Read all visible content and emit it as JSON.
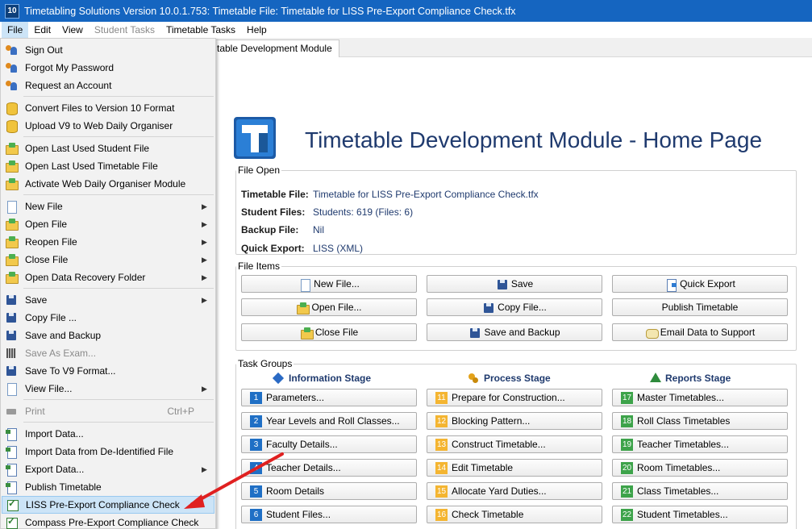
{
  "window": {
    "app_icon_text": "10",
    "title": "Timetabling Solutions Version 10.0.1.753: Timetable File: Timetable for LISS Pre-Export Compliance Check.tfx"
  },
  "menubar": [
    "File",
    "Edit",
    "View",
    "Student Tasks",
    "Timetable Tasks",
    "Help"
  ],
  "tab": {
    "label": "Timetable Development Module",
    "visible_label": "table Development Module"
  },
  "page": {
    "title": "Timetable Development Module - Home Page"
  },
  "file_open": {
    "legend": "File Open",
    "rows": [
      {
        "key": "Timetable File:",
        "value": "Timetable for LISS Pre-Export Compliance Check.tfx"
      },
      {
        "key": "Student Files:",
        "value": "Students: 619 (Files: 6)"
      },
      {
        "key": "Backup File:",
        "value": "Nil"
      },
      {
        "key": "Quick Export:",
        "value": "LISS (XML)"
      }
    ]
  },
  "file_items": {
    "legend": "File Items",
    "buttons": [
      {
        "label": "New File...",
        "icon": "new-file-icon"
      },
      {
        "label": "Save",
        "icon": "save-icon"
      },
      {
        "label": "Quick Export",
        "icon": "export-icon"
      },
      {
        "label": "Open File...",
        "icon": "open-folder-icon"
      },
      {
        "label": "Copy File...",
        "icon": "save-icon"
      },
      {
        "label": "Publish Timetable",
        "icon": ""
      },
      {
        "label": "Close File",
        "icon": "close-folder-icon"
      },
      {
        "label": "Save and Backup",
        "icon": "save-icon"
      },
      {
        "label": "Email Data to Support",
        "icon": "email-icon"
      }
    ]
  },
  "task_groups": {
    "legend": "Task Groups",
    "stages": [
      {
        "name": "Information Stage",
        "icon": "info-diamond-icon",
        "color": "#1f6fc5",
        "tasks": [
          {
            "num": "1",
            "label": "Parameters..."
          },
          {
            "num": "2",
            "label": "Year Levels and Roll Classes..."
          },
          {
            "num": "3",
            "label": "Faculty Details..."
          },
          {
            "num": "4",
            "label": "Teacher Details..."
          },
          {
            "num": "5",
            "label": "Room Details"
          },
          {
            "num": "6",
            "label": "Student Files..."
          }
        ]
      },
      {
        "name": "Process Stage",
        "icon": "gears-icon",
        "color": "#f4b531",
        "tasks": [
          {
            "num": "11",
            "label": "Prepare for Construction..."
          },
          {
            "num": "12",
            "label": "Blocking Pattern..."
          },
          {
            "num": "13",
            "label": "Construct Timetable..."
          },
          {
            "num": "14",
            "label": "Edit Timetable"
          },
          {
            "num": "15",
            "label": "Allocate Yard Duties..."
          },
          {
            "num": "16",
            "label": "Check Timetable"
          }
        ]
      },
      {
        "name": "Reports Stage",
        "icon": "tree-icon",
        "color": "#3da34a",
        "tasks": [
          {
            "num": "17",
            "label": "Master Timetables..."
          },
          {
            "num": "18",
            "label": "Roll Class Timetables"
          },
          {
            "num": "19",
            "label": "Teacher Timetables..."
          },
          {
            "num": "20",
            "label": "Room Timetables..."
          },
          {
            "num": "21",
            "label": "Class Timetables..."
          },
          {
            "num": "22",
            "label": "Student Timetables..."
          }
        ]
      }
    ]
  },
  "file_menu": [
    {
      "label": "Sign Out",
      "icon": "users-icon"
    },
    {
      "label": "Forgot My Password",
      "icon": "users-icon"
    },
    {
      "label": "Request an Account",
      "icon": "users-icon"
    },
    {
      "sep": true
    },
    {
      "label": "Convert Files to Version 10 Format",
      "icon": "database-icon"
    },
    {
      "label": "Upload V9 to Web Daily Organiser",
      "icon": "database-icon"
    },
    {
      "sep": true
    },
    {
      "label": "Open Last Used Student File",
      "icon": "folder-icon"
    },
    {
      "label": "Open Last Used Timetable File",
      "icon": "folder-icon"
    },
    {
      "label": "Activate Web Daily Organiser Module",
      "icon": "folder-icon"
    },
    {
      "sep": true
    },
    {
      "label": "New File",
      "icon": "document-icon",
      "submenu": true
    },
    {
      "label": "Open File",
      "icon": "folder-icon",
      "submenu": true
    },
    {
      "label": "Reopen File",
      "icon": "folder-icon",
      "submenu": true
    },
    {
      "label": "Close File",
      "icon": "folder-icon",
      "submenu": true
    },
    {
      "label": "Open Data Recovery Folder",
      "icon": "folder-icon",
      "submenu": true
    },
    {
      "sep": true
    },
    {
      "label": "Save",
      "icon": "save-icon",
      "submenu": true
    },
    {
      "label": "Copy File ...",
      "icon": "save-icon"
    },
    {
      "label": "Save and Backup",
      "icon": "save-icon"
    },
    {
      "label": "Save As Exam...",
      "icon": "grid-icon",
      "disabled": true
    },
    {
      "label": "Save To V9 Format...",
      "icon": "save-icon"
    },
    {
      "label": "View File...",
      "icon": "document-icon",
      "submenu": true
    },
    {
      "sep": true
    },
    {
      "label": "Print",
      "icon": "print-icon",
      "disabled": true,
      "shortcut": "Ctrl+P"
    },
    {
      "sep": true
    },
    {
      "label": "Import Data...",
      "icon": "import-icon"
    },
    {
      "label": "Import Data from De-Identified File",
      "icon": "import-icon"
    },
    {
      "label": "Export Data...",
      "icon": "import-icon",
      "submenu": true
    },
    {
      "label": "Publish Timetable",
      "icon": "import-icon"
    },
    {
      "label": "LISS Pre-Export Compliance Check",
      "icon": "checkbox-icon",
      "highlighted": true
    },
    {
      "label": "Compass Pre-Export Compliance Check",
      "icon": "checkbox-icon"
    }
  ],
  "annotation_arrow_color": "#e02020"
}
